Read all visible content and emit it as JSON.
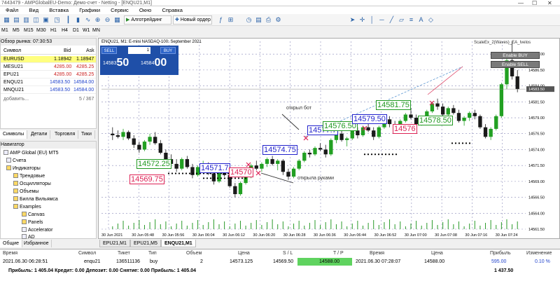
{
  "window": {
    "title": "7443479 - AMPGlobalEU-Demo: Демо-счет - Netting - [ENQU21,M1]"
  },
  "menu": [
    "Файл",
    "Вид",
    "Вставка",
    "Графики",
    "Сервис",
    "Окно",
    "Справка"
  ],
  "toolbar": {
    "algo_label": "Алготрейдинг",
    "new_order_label": "Новый ордер"
  },
  "timeframes": [
    "M1",
    "M5",
    "M15",
    "M30",
    "H1",
    "H4",
    "D1",
    "W1",
    "MN"
  ],
  "market_watch": {
    "header": "Обзор рынка: 07:30:53",
    "col_symbol": "Символ",
    "col_bid": "Bid",
    "col_ask": "Ask",
    "rows": [
      {
        "symbol": "EURUSD",
        "bid": "1.18942",
        "ask": "1.18947"
      },
      {
        "symbol": "MESU21",
        "bid": "4285.00",
        "ask": "4285.25"
      },
      {
        "symbol": "EPU21",
        "bid": "4285.00",
        "ask": "4285.25"
      },
      {
        "symbol": "ENQU21",
        "bid": "14583.50",
        "ask": "14584.00"
      },
      {
        "symbol": "MNQU21",
        "bid": "14583.50",
        "ask": "14584.00"
      }
    ],
    "add_label": "добавить...",
    "count": "5 / 367",
    "tabs": [
      "Символы",
      "Детали",
      "Торговля",
      "Тики"
    ]
  },
  "navigator": {
    "header": "Навигатор",
    "items": [
      "AMP Global (EU) MT5",
      "Счета",
      "Индикаторы",
      "Трендовые",
      "Осцилляторы",
      "Объемы",
      "Билла Вильямса",
      "Examples",
      "Canvas",
      "Panels",
      "Accelerator",
      "AD"
    ],
    "tabs": [
      "Общие",
      "Избранное"
    ]
  },
  "chart": {
    "title": "ENQU21, M1: E-mini NASDAQ-100: September 2021",
    "symbol": "ENQU21",
    "ea_name": "ScaleEx_2(Waves)_EA_Ivelos",
    "enable_buy": "Enable BUY",
    "enable_sell": "Enable SELL",
    "trade_panel": {
      "sell": "SELL",
      "buy": "BUY",
      "volume": "1",
      "sell_small": "14583",
      "sell_big": "50",
      "buy_small": "14584",
      "buy_big": "00"
    },
    "annotations": [
      "открыл бот",
      "открыла руками"
    ],
    "labels_blue": [
      "14571.7",
      "14574.75",
      "14577.7",
      "14579.50"
    ],
    "labels_green": [
      "14572.25",
      "14576.50",
      "14581.75",
      "14578.50"
    ],
    "labels_red": [
      "14569.75",
      "14570",
      "14576"
    ],
    "price_ticks": [
      "14589.00",
      "14586.50",
      "14584.00",
      "14581.50",
      "14579.00",
      "14576.50",
      "14574.00",
      "14571.50",
      "14569.00",
      "14566.50",
      "14564.00",
      "14561.50"
    ],
    "current_price": "14583.50",
    "time_ticks": [
      "30 Jun 2021",
      "30 Jun 05:48",
      "30 Jun 05:56",
      "30 Jun 06:04",
      "30 Jun 06:12",
      "30 Jun 06:20",
      "30 Jun 06:28",
      "30 Jun 06:36",
      "30 Jun 06:44",
      "30 Jun 06:52",
      "30 Jun 07:00",
      "30 Jun 07:08",
      "30 Jun 07:16",
      "30 Jun 07:24"
    ],
    "tabs": [
      "EPU21,M1",
      "EPU21,M5",
      "ENQU21,M1"
    ]
  },
  "chart_data": {
    "type": "candlestick",
    "title": "ENQU21, M1: E-mini NASDAQ-100: September 2021",
    "ylim": [
      14561.5,
      14591
    ],
    "candles": [
      [
        14576.5,
        14577.5,
        14575.5,
        14576.25
      ],
      [
        14576.25,
        14577,
        14575.75,
        14576
      ],
      [
        14576,
        14577.25,
        14575.5,
        14576.75
      ],
      [
        14576.75,
        14577,
        14575.5,
        14575.75
      ],
      [
        14575.75,
        14576.25,
        14574.25,
        14574.75
      ],
      [
        14574.75,
        14575.25,
        14573.5,
        14574
      ],
      [
        14574,
        14575.5,
        14573.75,
        14575.25
      ],
      [
        14575.25,
        14576.5,
        14574.75,
        14576
      ],
      [
        14576,
        14576.75,
        14574.75,
        14575
      ],
      [
        14575,
        14575.5,
        14573.25,
        14573.5
      ],
      [
        14573.5,
        14574,
        14572,
        14572.5
      ],
      [
        14572.5,
        14573.25,
        14571.5,
        14571.75
      ],
      [
        14571.75,
        14572.5,
        14570.5,
        14571
      ],
      [
        14571,
        14572.75,
        14570.75,
        14572.5
      ],
      [
        14572.5,
        14573,
        14571,
        14571.25
      ],
      [
        14571.25,
        14571.75,
        14569.5,
        14570
      ],
      [
        14570,
        14571.5,
        14569.75,
        14571.25
      ],
      [
        14571.25,
        14572.25,
        14570.75,
        14571.75
      ],
      [
        14571.75,
        14572,
        14570,
        14570.25
      ],
      [
        14570.25,
        14570.75,
        14568.5,
        14569
      ],
      [
        14569,
        14571,
        14568.75,
        14570.75
      ],
      [
        14570.75,
        14571.5,
        14569.75,
        14570
      ],
      [
        14570,
        14570.25,
        14568,
        14568.25
      ],
      [
        14568.25,
        14568.75,
        14566.5,
        14567
      ],
      [
        14567,
        14569,
        14566.75,
        14568.75
      ],
      [
        14568.75,
        14570.25,
        14568.5,
        14570
      ],
      [
        14570,
        14571.75,
        14569.5,
        14571.5
      ],
      [
        14571.5,
        14572.25,
        14570.75,
        14571
      ],
      [
        14571,
        14572,
        14570.5,
        14571.75
      ],
      [
        14571.75,
        14572.75,
        14571.25,
        14572.5
      ],
      [
        14572.5,
        14573,
        14571.5,
        14571.75
      ],
      [
        14571.75,
        14572.5,
        14570.75,
        14572.25
      ],
      [
        14572.25,
        14572.5,
        14570,
        14570.5
      ],
      [
        14570.5,
        14571,
        14569.25,
        14569.75
      ],
      [
        14569.75,
        14571.25,
        14569.5,
        14571
      ],
      [
        14571,
        14572.5,
        14570.75,
        14572.25
      ],
      [
        14572.25,
        14573.75,
        14572,
        14573.5
      ],
      [
        14573.5,
        14574,
        14572.75,
        14573.25
      ],
      [
        14573.25,
        14574.5,
        14573,
        14574.25
      ],
      [
        14574.25,
        14575,
        14573.75,
        14574
      ],
      [
        14574,
        14574.75,
        14572.75,
        14573.25
      ],
      [
        14573.25,
        14575.75,
        14573,
        14575.5
      ],
      [
        14575.5,
        14576.75,
        14575,
        14576.5
      ],
      [
        14576.5,
        14577,
        14575.25,
        14575.5
      ],
      [
        14575.5,
        14576,
        14574.5,
        14575.75
      ],
      [
        14575.75,
        14577.25,
        14575.5,
        14577
      ],
      [
        14577,
        14577.5,
        14575.75,
        14576.25
      ],
      [
        14576.25,
        14577.75,
        14576,
        14577.5
      ],
      [
        14577.5,
        14578.25,
        14576.75,
        14577
      ],
      [
        14577,
        14577.5,
        14575.5,
        14576
      ],
      [
        14576,
        14577.75,
        14575.75,
        14577.5
      ],
      [
        14577.5,
        14579,
        14577.25,
        14578.75
      ],
      [
        14578.75,
        14579.25,
        14577.5,
        14578
      ],
      [
        14578,
        14578.5,
        14576.75,
        14577.25
      ],
      [
        14577.25,
        14578.75,
        14577,
        14578.5
      ],
      [
        14578.5,
        14579.75,
        14578.25,
        14579.5
      ],
      [
        14579.5,
        14580.5,
        14578.75,
        14579
      ],
      [
        14579,
        14579.5,
        14577.5,
        14578
      ],
      [
        14578,
        14579.25,
        14577.75,
        14579
      ],
      [
        14579,
        14580.25,
        14578.5,
        14580
      ],
      [
        14580,
        14581.5,
        14579.75,
        14581.25
      ],
      [
        14581.25,
        14582,
        14580.25,
        14580.75
      ],
      [
        14580.75,
        14581.25,
        14579.25,
        14579.5
      ],
      [
        14579.5,
        14580.75,
        14579.25,
        14580.5
      ],
      [
        14580.5,
        14581,
        14579.5,
        14579.75
      ],
      [
        14579.75,
        14580.25,
        14578.25,
        14578.5
      ],
      [
        14578.5,
        14579.25,
        14577.75,
        14579
      ],
      [
        14579,
        14580,
        14578.5,
        14579.75
      ],
      [
        14579.75,
        14580.25,
        14578.75,
        14579.25
      ],
      [
        14579.25,
        14579.5,
        14577.25,
        14577.5
      ],
      [
        14577.5,
        14578,
        14575.75,
        14576
      ],
      [
        14576,
        14577.5,
        14575.5,
        14577.25
      ],
      [
        14577.25,
        14579.5,
        14577,
        14579.25
      ],
      [
        14579.25,
        14584.5,
        14579,
        14584.25
      ],
      [
        14584.25,
        14588.5,
        14583.5,
        14588
      ],
      [
        14588,
        14591,
        14585,
        14585.5
      ],
      [
        14585.5,
        14586.5,
        14583,
        14583.5
      ]
    ]
  },
  "terminal": {
    "headers": [
      "Время",
      "Символ",
      "Тикет",
      "Тип",
      "Объем",
      "Цена",
      "S / L",
      "T / P",
      "Время",
      "Цена",
      "Прибыль",
      "Изменение"
    ],
    "row": {
      "time": "2021.06.30 06:28:51",
      "symbol": "enqu21",
      "ticket": "136511136",
      "type": "buy",
      "volume": "2",
      "price": "14573.125",
      "sl": "14569.50",
      "tp": "14588.00",
      "time2": "2021.06.30 07:28:07",
      "price2": "14588.00",
      "profit": "595.00",
      "change": "0.10 %"
    },
    "totals": "Прибыль: 1 405.04  Кредит: 0.00  Депозит: 0.00  Снятие: 0.00  Прибыль: 1 405.04",
    "total_value": "1 437.50"
  }
}
